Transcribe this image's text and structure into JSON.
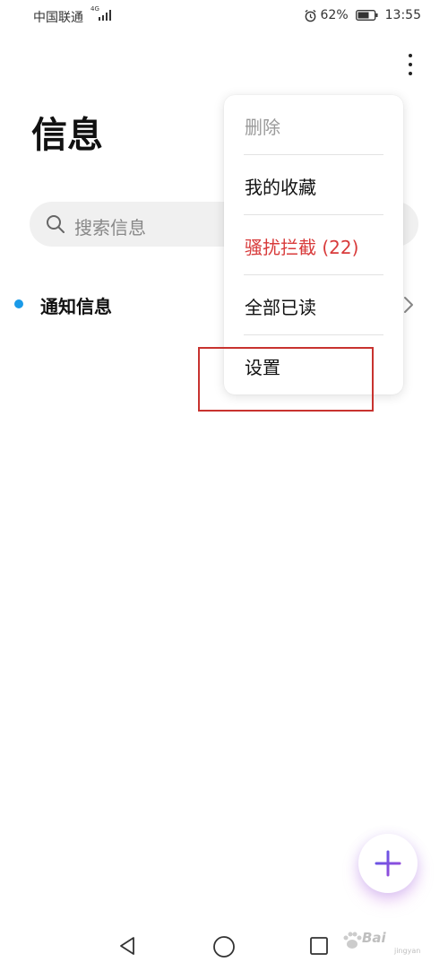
{
  "status_bar": {
    "carrier": "中国联通",
    "network_type": "4G",
    "battery_percent": "62%",
    "time": "13:55"
  },
  "header": {
    "title": "信息",
    "more_icon": "more-vertical-icon"
  },
  "search": {
    "placeholder": "搜索信息"
  },
  "conversations": [
    {
      "label": "通知信息",
      "unread": true
    }
  ],
  "overflow_menu": {
    "items": [
      {
        "label": "删除",
        "state": "disabled"
      },
      {
        "label": "我的收藏",
        "state": "normal"
      },
      {
        "label": "骚扰拦截 (22)",
        "state": "danger"
      },
      {
        "label": "全部已读",
        "state": "normal"
      },
      {
        "label": "设置",
        "state": "normal",
        "highlighted": true
      }
    ]
  },
  "fab": {
    "icon": "plus-icon"
  },
  "navigation": {
    "icons": [
      "back-icon",
      "home-icon",
      "recents-icon"
    ]
  },
  "watermark": {
    "text": "Bai",
    "sub": "jingyan"
  },
  "colors": {
    "accent_blue": "#1a9ae8",
    "danger_red": "#d83b3b",
    "highlight_red": "#c8332f",
    "fab_purple": "#7a52e0",
    "search_bg": "#f0f0f0"
  }
}
